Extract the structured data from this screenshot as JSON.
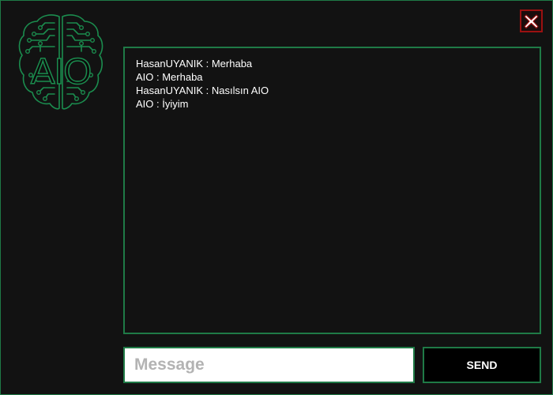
{
  "window": {
    "accent_color": "#1f7a46",
    "background_color": "#121212",
    "close_icon": "close-icon",
    "close_color": "#9b1111"
  },
  "logo": {
    "text": "AIO",
    "icon": "brain-circuit-icon",
    "color": "#1b8c4e"
  },
  "chat": {
    "messages": [
      "HasanUYANIK : Merhaba",
      "AIO : Merhaba",
      "HasanUYANIK : Nasılsın AIO",
      "AIO : İyiyim"
    ]
  },
  "input": {
    "placeholder": "Message",
    "value": ""
  },
  "send": {
    "label": "SEND"
  }
}
